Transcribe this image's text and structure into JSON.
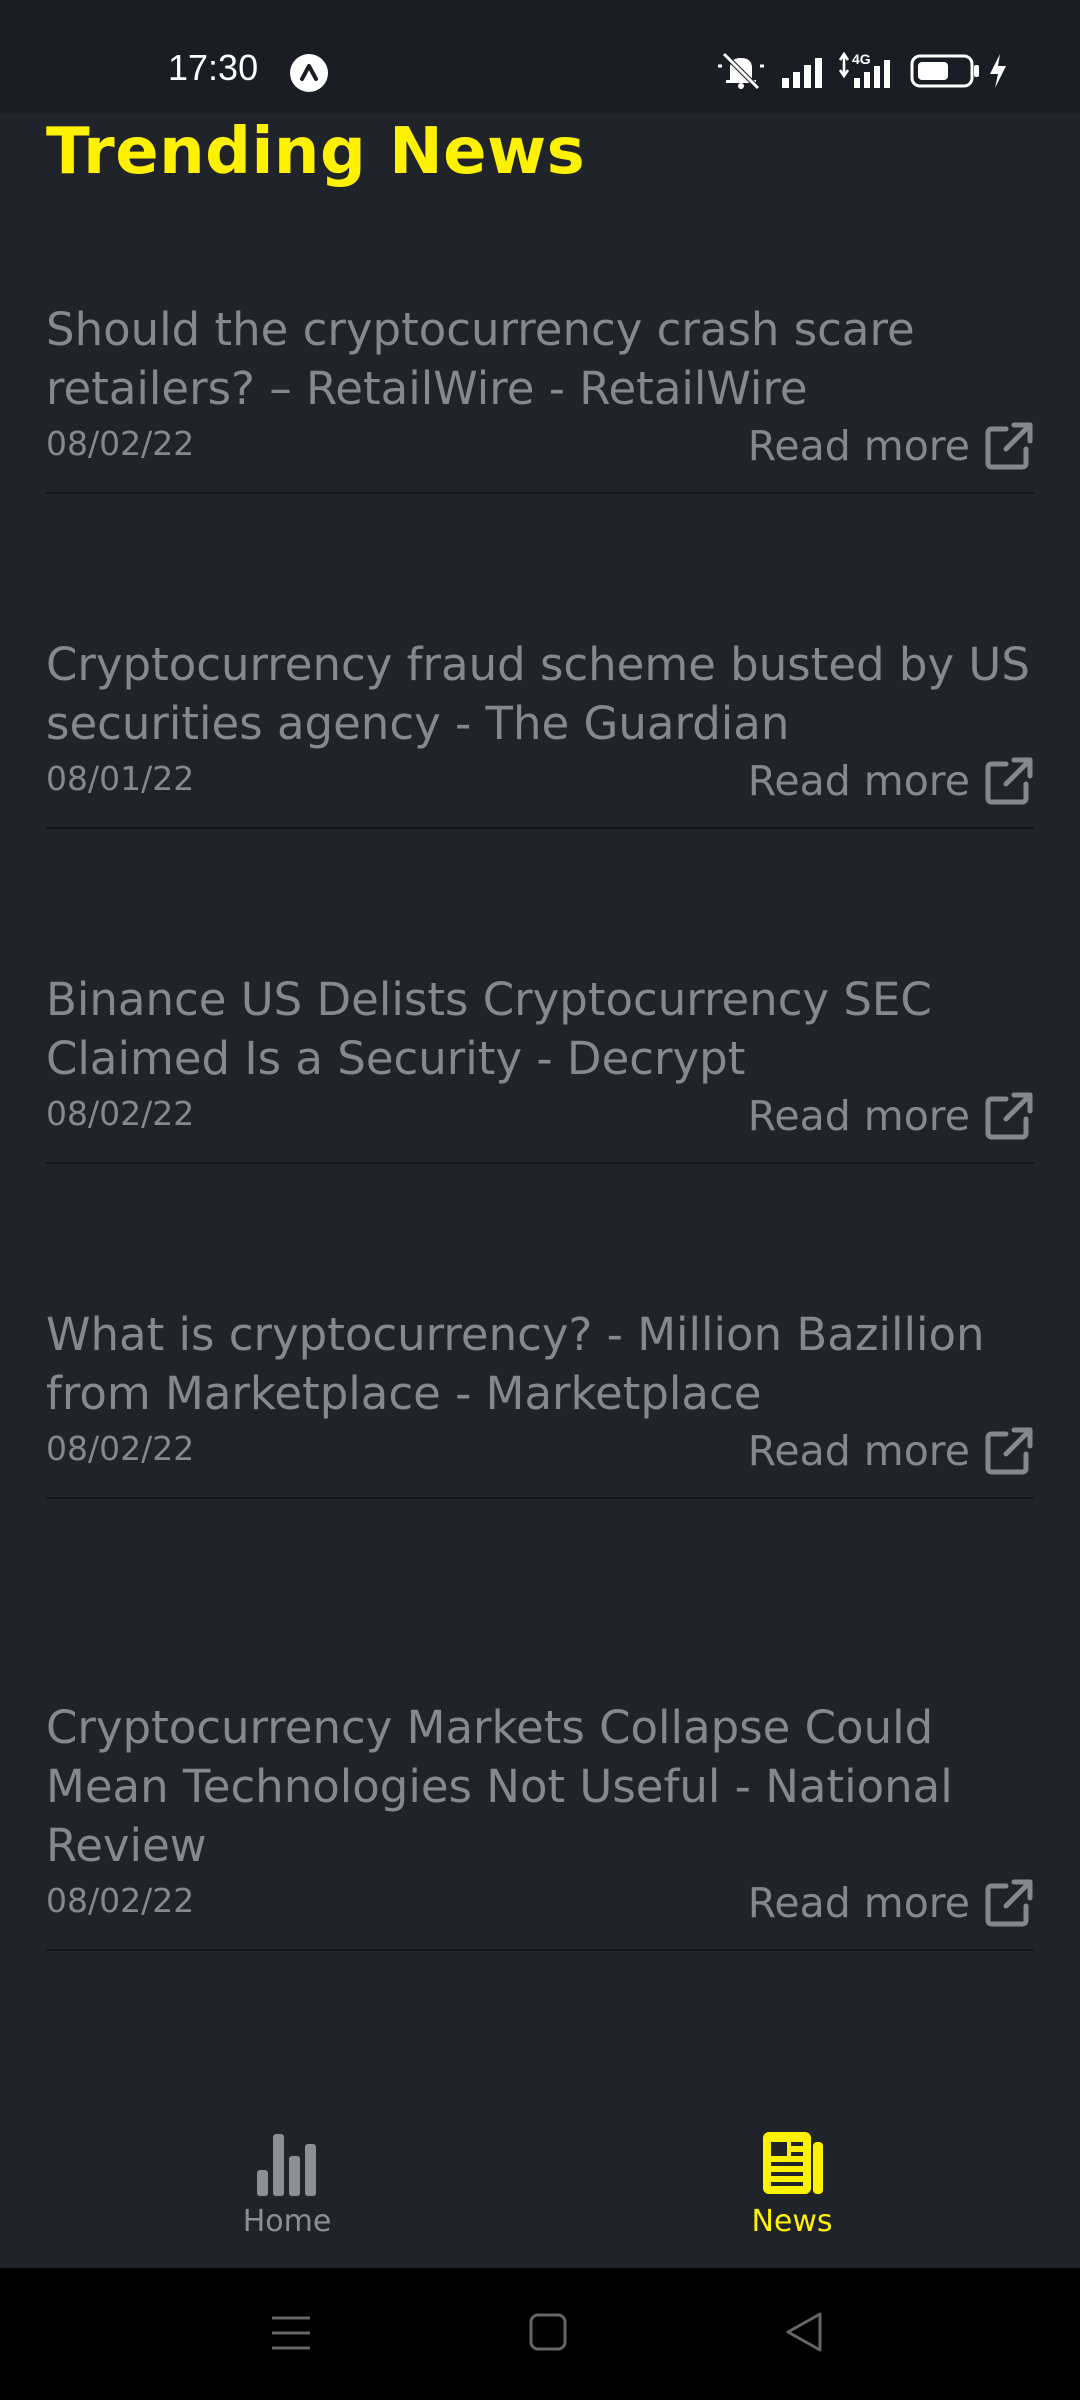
{
  "status_bar": {
    "time": "17:30",
    "network_label": "4G"
  },
  "page": {
    "title": "Trending News"
  },
  "news": [
    {
      "headline": "Should the cryptocurrency crash scare retailers? – RetailWire - RetailWire",
      "date": "08/02/22",
      "read_more": "Read more"
    },
    {
      "headline": "Cryptocurrency fraud scheme busted by US securities agency - The Guardian",
      "date": "08/01/22",
      "read_more": "Read more"
    },
    {
      "headline": "Binance US Delists Cryptocurrency SEC Claimed Is a Security - Decrypt",
      "date": "08/02/22",
      "read_more": "Read more"
    },
    {
      "headline": "What is cryptocurrency? - Million Bazillion from Marketplace - Marketplace",
      "date": "08/02/22",
      "read_more": "Read more"
    },
    {
      "headline": "Cryptocurrency Markets Collapse Could Mean Technologies Not Useful - National Review",
      "date": "08/02/22",
      "read_more": "Read more"
    }
  ],
  "bottom_nav": {
    "tabs": [
      {
        "label": "Home",
        "icon": "bar-chart-icon",
        "active": false
      },
      {
        "label": "News",
        "icon": "newspaper-icon",
        "active": true
      }
    ]
  },
  "colors": {
    "background": "#21232b",
    "accent": "#fff200",
    "text_muted": "#878790",
    "inactive_icon": "#8e8e96"
  }
}
